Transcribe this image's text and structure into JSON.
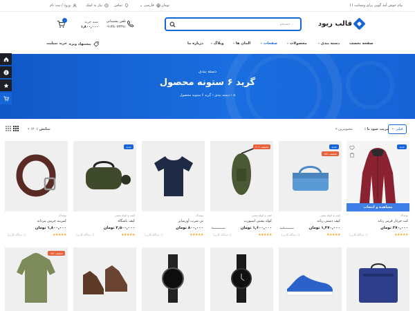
{
  "topbar": {
    "welcome": "پیام خوش آمد گویی برای وبسایت ا ا",
    "currency": "تومان",
    "language": "فارسی",
    "location": "تماس",
    "help": "نیاز به کمک",
    "account": "ورود / ثبت نام"
  },
  "header": {
    "logo_text": "قالب ریود",
    "search_placeholder": "جستجو ...",
    "support_label": "تلفن پشتیبانی",
    "support_number": "۰۹۱۳۸۰۷۳۳۹۱",
    "cart_label": "سبد خرید",
    "cart_total": "۱,۸۰۰,۰۰۰",
    "cart_count": "۰"
  },
  "nav": {
    "items": [
      {
        "label": "صفحه نخست",
        "active": false,
        "dropdown": false
      },
      {
        "label": "دسته بندی",
        "active": false,
        "dropdown": true
      },
      {
        "label": "محصولات",
        "active": false,
        "dropdown": true
      },
      {
        "label": "صفحات",
        "active": true,
        "dropdown": true
      },
      {
        "label": "المان ها",
        "active": false,
        "dropdown": true
      },
      {
        "label": "وبلاگ",
        "active": false,
        "dropdown": true
      },
      {
        "label": "درباره ما",
        "active": false,
        "dropdown": false
      }
    ],
    "special_offer": "پیشنهاد ویژه",
    "buy_theme": "خرید تمپلیت"
  },
  "hero": {
    "subtitle": "دسته بندی",
    "title": "گرید ۶ ستونه محصول",
    "breadcrumb": "⌂ › دسته بندی › گرید ۶ ستونه محصول"
  },
  "toolbar": {
    "filter_label": "فیلتر",
    "sort_label": "مرتب شود با :",
    "sort_value": "محبوبترین",
    "show_label": "نمایش :",
    "show_value": "۱۲"
  },
  "products": [
    {
      "name": "کت خزدار قرمز زنانه",
      "category": "پوشاک",
      "price": "۳۷۰,۰۰۰ تومان",
      "old_price": "",
      "badges": [
        "جدید"
      ],
      "rating": "★★★★★",
      "reviews": "(۱ دیدگاه کاربر)",
      "quick_view": "مشاهده و انتخاب"
    },
    {
      "name": "کیف دستی زنانه",
      "category": "کیف و کوله پشتی",
      "price": "۱,۳۷۰,۰۰۰ تومان",
      "old_price": "۱,۴۰۰,۰۰۰",
      "badges": [
        "جدید",
        "۱۵٪ تخفیف"
      ],
      "rating": "★★★★★",
      "reviews": "(۱ دیدگاه کاربر)",
      "quick_view": ""
    },
    {
      "name": "کوله پشتی اسپورت",
      "category": "کیف و کوله پشتی",
      "price": "۱,۶۰۰,۰۰۰ تومان",
      "old_price": "۲,۰۰۰,۰۰۰",
      "badges": [
        "۲۰٪ تخفیف"
      ],
      "rating": "★★★★★",
      "reviews": "(۱ دیدگاه کاربر)",
      "quick_view": ""
    },
    {
      "name": "تی شرت آورسایز",
      "category": "پوشاک",
      "price": "۸۰۰,۰۰۰ تومان",
      "old_price": "",
      "badges": [],
      "rating": "★★★★★",
      "reviews": "(۱ دیدگاه کاربر)",
      "quick_view": ""
    },
    {
      "name": "کیف باشگاه",
      "category": "کیف و کوله پشتی",
      "price": "۴,۵۰۰,۰۰۰ تومان",
      "old_price": "",
      "badges": [
        "جدید"
      ],
      "rating": "★★★★★",
      "reviews": "(۱ دیدگاه کاربر)",
      "quick_view": ""
    },
    {
      "name": "کمربند چرمی مردانه",
      "category": "پوشاک",
      "price": "۱,۸۰۰,۰۰۰ تومان",
      "old_price": "",
      "badges": [],
      "rating": "★★★★★",
      "reviews": "(۱ دیدگاه کاربر)",
      "quick_view": ""
    },
    {
      "name": "",
      "category": "",
      "price": "",
      "old_price": "",
      "badges": [],
      "rating": "",
      "reviews": "",
      "quick_view": ""
    },
    {
      "name": "",
      "category": "",
      "price": "",
      "old_price": "",
      "badges": [],
      "rating": "",
      "reviews": "",
      "quick_view": ""
    },
    {
      "name": "",
      "category": "",
      "price": "",
      "old_price": "",
      "badges": [],
      "rating": "",
      "reviews": "",
      "quick_view": ""
    },
    {
      "name": "",
      "category": "",
      "price": "",
      "old_price": "",
      "badges": [],
      "rating": "",
      "reviews": "",
      "quick_view": ""
    },
    {
      "name": "",
      "category": "",
      "price": "",
      "old_price": "",
      "badges": [],
      "rating": "",
      "reviews": "",
      "quick_view": ""
    },
    {
      "name": "",
      "category": "",
      "price": "",
      "old_price": "",
      "badges": [
        "۱۵٪ تخفیف"
      ],
      "rating": "",
      "reviews": "",
      "quick_view": ""
    }
  ],
  "colors": {
    "accent": "#1565d8",
    "discount": "#e8603c",
    "star": "#f4a623",
    "float_bar": "#1d1f27"
  }
}
